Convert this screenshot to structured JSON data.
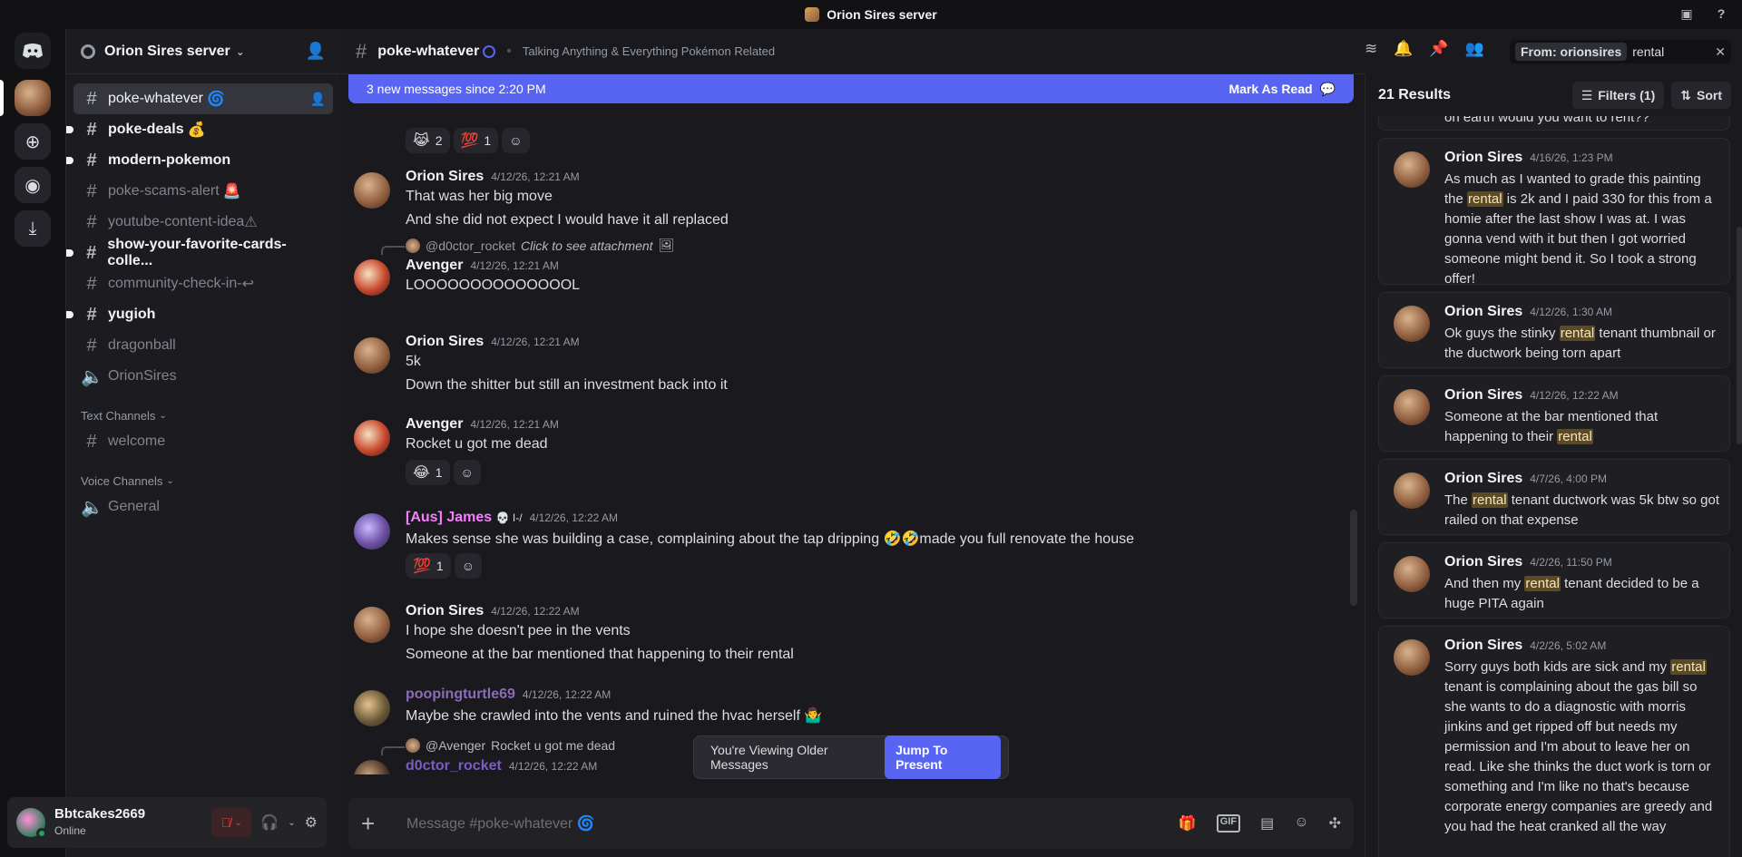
{
  "window": {
    "title": "Orion Sires server"
  },
  "server": {
    "name": "Orion Sires server"
  },
  "channels": [
    {
      "name": "poke-whatever",
      "suffix": "🌀",
      "state": "active"
    },
    {
      "name": "poke-deals",
      "suffix": "💰",
      "state": "unread"
    },
    {
      "name": "modern-pokemon",
      "suffix": "",
      "state": "unread"
    },
    {
      "name": "poke-scams-alert",
      "suffix": "🚨",
      "state": "normal"
    },
    {
      "name": "youtube-content-idea",
      "suffix": "⚠",
      "state": "normal"
    },
    {
      "name": "show-your-favorite-cards-colle...",
      "suffix": "",
      "state": "unread"
    },
    {
      "name": "community-check-in-",
      "suffix": "↩",
      "state": "normal"
    },
    {
      "name": "yugioh",
      "suffix": "",
      "state": "unread"
    },
    {
      "name": "dragonball",
      "suffix": "",
      "state": "normal"
    },
    {
      "name": "OrionSires",
      "suffix": "",
      "state": "voice"
    }
  ],
  "categories": {
    "text": {
      "label": "Text Channels",
      "items": [
        "welcome"
      ]
    },
    "voice": {
      "label": "Voice Channels",
      "items": [
        "General"
      ]
    }
  },
  "user": {
    "name": "Bbtcakes2669",
    "status": "Online"
  },
  "chat": {
    "channel": "poke-whatever",
    "topic": "Talking Anything & Everything Pokémon Related",
    "new_messages": "3 new messages since 2:20 PM",
    "mark_read": "Mark As Read",
    "older_notice": "You're Viewing Older Messages",
    "jump": "Jump To Present",
    "composer_placeholder": "Message #poke-whatever 🌀"
  },
  "top_reactions": [
    {
      "emoji": "😹",
      "count": "2"
    },
    {
      "emoji": "💯",
      "count": "1"
    }
  ],
  "messages": [
    {
      "author": "Orion Sires",
      "time": "4/12/26, 12:21 AM",
      "lines": [
        "That was her big move",
        "And she did not expect I would have it all replaced"
      ]
    },
    {
      "author": "Avenger",
      "time": "4/12/26, 12:21 AM",
      "reply_user": "@d0ctor_rocket",
      "reply_text": "Click to see attachment",
      "lines": [
        "LOOOOOOOOOOOOOOL"
      ]
    },
    {
      "author": "Orion Sires",
      "time": "4/12/26, 12:21 AM",
      "lines": [
        "5k",
        "Down the shitter but still an investment back into it"
      ]
    },
    {
      "author": "Avenger",
      "time": "4/12/26, 12:21 AM",
      "lines": [
        "Rocket u got me dead"
      ],
      "reactions": [
        {
          "emoji": "😂",
          "count": "1"
        }
      ]
    },
    {
      "author": "[Aus] James",
      "badge": "💀 I-/",
      "time": "4/12/26, 12:22 AM",
      "lines": [
        "Makes sense she was building a case, complaining about the tap dripping 🤣🤣made you full renovate the house"
      ],
      "reactions": [
        {
          "emoji": "💯",
          "count": "1"
        }
      ]
    },
    {
      "author": "Orion Sires",
      "time": "4/12/26, 12:22 AM",
      "lines": [
        "I hope she doesn't pee in the vents",
        "Someone at the bar mentioned that happening to their rental"
      ]
    },
    {
      "author": "poopingturtle69",
      "time": "4/12/26, 12:22 AM",
      "lines": [
        "Maybe she crawled into the vents and ruined the hvac herself 🤷‍♂️"
      ]
    },
    {
      "author": "d0ctor_rocket",
      "time": "4/12/26, 12:22 AM",
      "reply_user": "@Avenger",
      "reply_text": "Rocket u got me dead",
      "lines": []
    }
  ],
  "search": {
    "filter_tag": "From: orionsires",
    "query": "rental",
    "count": "21 Results",
    "filters": "Filters (1)",
    "sort": "Sort",
    "top_snippet": "on earth would you want to rent??",
    "results": [
      {
        "author": "Orion Sires",
        "time": "4/16/26, 1:23 PM",
        "pre": "As much as I wanted to grade this painting the ",
        "hit": "rental",
        "post": " is 2k and I paid 330 for this from a homie after the last show I was at. I was gonna vend with it but then I got worried someone might bend it. So I took a strong offer!"
      },
      {
        "author": "Orion Sires",
        "time": "4/12/26, 1:30 AM",
        "pre": "Ok guys the stinky ",
        "hit": "rental",
        "post": " tenant thumbnail or the ductwork being torn apart"
      },
      {
        "author": "Orion Sires",
        "time": "4/12/26, 12:22 AM",
        "pre": "Someone at the bar mentioned that happening to their ",
        "hit": "rental",
        "post": ""
      },
      {
        "author": "Orion Sires",
        "time": "4/7/26, 4:00 PM",
        "pre": "The ",
        "hit": "rental",
        "post": " tenant ductwork was 5k btw so got railed on that expense"
      },
      {
        "author": "Orion Sires",
        "time": "4/2/26, 11:50 PM",
        "pre": "And then my ",
        "hit": "rental",
        "post": " tenant decided to be a huge PITA again"
      },
      {
        "author": "Orion Sires",
        "time": "4/2/26, 5:02 AM",
        "pre": "Sorry guys both kids are sick and my ",
        "hit": "rental",
        "post": " tenant is complaining about the gas bill so she wants to do a diagnostic with morris jinkins and get ripped off but needs my permission and I'm about to leave her on read. Like she thinks the duct work is torn or something and I'm like no that's because corporate energy companies are greedy and you had the heat cranked all the way"
      }
    ]
  },
  "colors": {
    "accent": "#5865f2",
    "highlight": "#5c4a22",
    "james": "#f47fff",
    "turtle": "#8e6ab8",
    "rocket": "#7c5cc4"
  }
}
